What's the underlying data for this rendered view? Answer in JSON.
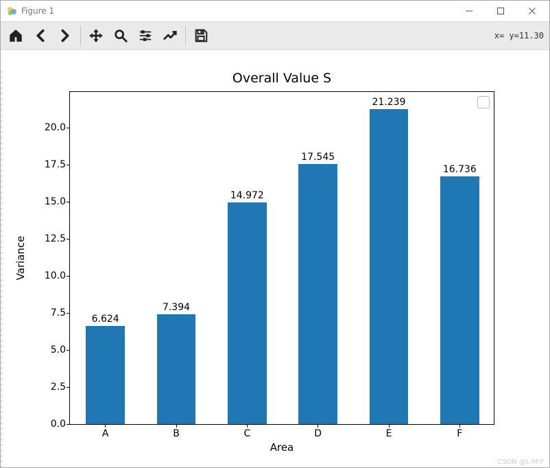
{
  "window": {
    "title": "Figure 1",
    "controls": {
      "minimize": "minimize",
      "maximize": "maximize",
      "close": "close"
    }
  },
  "toolbar": {
    "home": "Home",
    "back": "Back",
    "forward": "Forward",
    "pan": "Pan",
    "zoom": "Zoom",
    "subplots": "Configure subplots",
    "axes": "Edit axis",
    "save": "Save",
    "coord": "x=  y=11.30"
  },
  "chart_data": {
    "type": "bar",
    "title": "Overall Value S",
    "xlabel": "Area",
    "ylabel": "Variance",
    "categories": [
      "A",
      "B",
      "C",
      "D",
      "E",
      "F"
    ],
    "values": [
      6.624,
      7.394,
      14.972,
      17.545,
      21.239,
      16.736
    ],
    "value_labels": [
      "6.624",
      "7.394",
      "14.972",
      "17.545",
      "21.239",
      "16.736"
    ],
    "ylim": [
      0,
      22.5
    ],
    "yticks": [
      0.0,
      2.5,
      5.0,
      7.5,
      10.0,
      12.5,
      15.0,
      17.5,
      20.0
    ],
    "ytick_labels": [
      "0.0",
      "2.5",
      "5.0",
      "7.5",
      "10.0",
      "12.5",
      "15.0",
      "17.5",
      "20.0"
    ],
    "bar_color": "#1f77b4",
    "legend_visible": true
  },
  "watermark": "CSDN @L-M-Y"
}
